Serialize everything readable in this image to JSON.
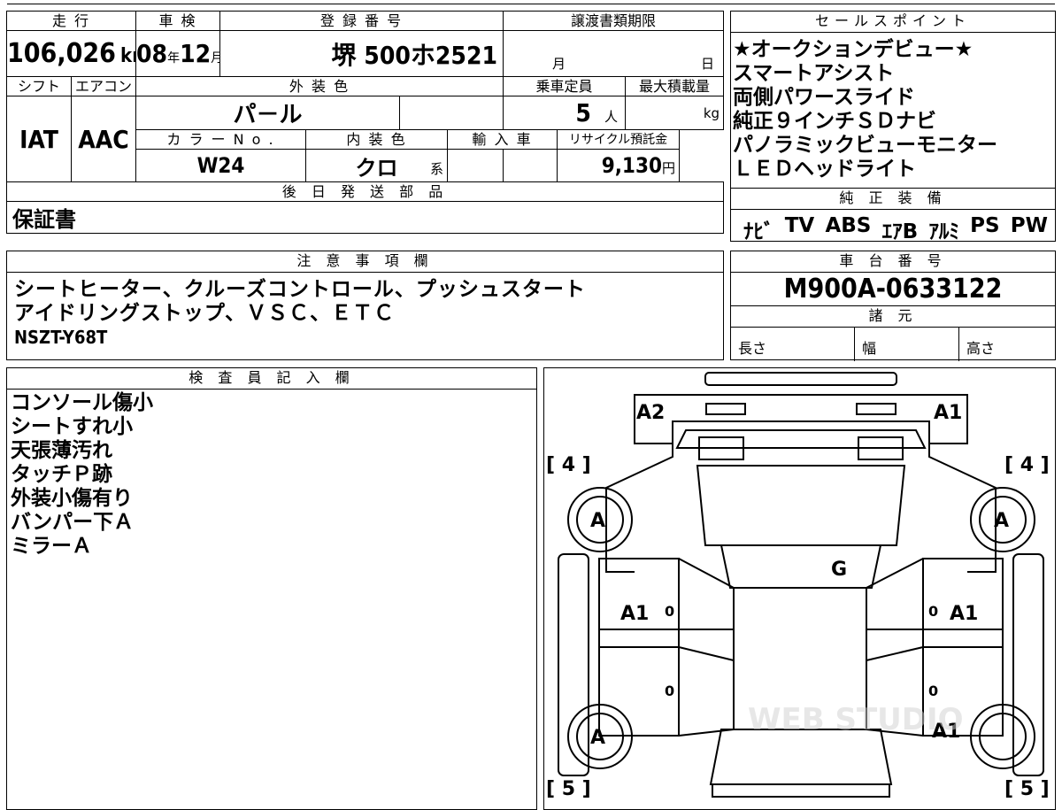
{
  "main_table": {
    "h_mileage": "走 行",
    "h_inspection": "車 検",
    "h_registration": "登 録 番 号",
    "h_transfer_deadline": "譲渡書類期限",
    "mileage": "106,026",
    "mileage_unit": "km",
    "inspection_year": "08",
    "inspection_year_unit": "年",
    "inspection_month": "12",
    "inspection_month_unit": "月",
    "registration_plate": "堺 500ホ2521",
    "transfer_month_unit": "月",
    "transfer_day_unit": "日",
    "h_shift": "シフト",
    "h_aircon": "エアコン",
    "h_exterior_color": "外 装 色",
    "h_capacity": "乗車定員",
    "h_max_load": "最大積載量",
    "shift": "IAT",
    "aircon": "AAC",
    "exterior_color": "パ－ル",
    "capacity": "5",
    "capacity_unit": "人",
    "max_load_unit": "kg",
    "h_color_no": "カ ラ ー N o .",
    "h_interior_color": "内 装 色",
    "h_imported": "輸 入 車",
    "h_recycle_fee": "リサイクル預託金",
    "color_no": "W24",
    "interior_color": "クロ",
    "interior_color_suffix": "系",
    "recycle_fee": "9,130",
    "recycle_fee_unit": "円",
    "h_later_parts": "後 日 発 送 部 品",
    "later_parts": "保証書"
  },
  "sales_points": {
    "header": "セールスポイント",
    "lines": [
      "★オークションデビュー★",
      "スマートアシスト",
      "両側パワースライド",
      "純正９インチＳＤナビ",
      "パノラミックビューモニター",
      "ＬＥＤヘッドライト"
    ]
  },
  "standard_equipment": {
    "header": "純 正 装 備",
    "items": [
      "ﾅﾋﾞ",
      "TV",
      "ABS",
      "ｴｱB",
      "ｱﾙﾐ",
      "PS",
      "PW"
    ]
  },
  "notes": {
    "header": "注 意 事 項 欄",
    "lines": [
      "シートヒーター、クルーズコントロール、プッシュスタート",
      "アイドリングストップ、ＶＳＣ、ＥＴＣ"
    ],
    "model_code": "NSZT-Y68T"
  },
  "chassis": {
    "header": "車 台 番 号",
    "number": "M900A-0633122",
    "specs_header": "諸 元",
    "length_label": "長さ",
    "width_label": "幅",
    "height_label": "高さ"
  },
  "inspector": {
    "header": "検 査 員 記 入 欄",
    "lines": [
      "コンソール傷小",
      "シートすれ小",
      "天張薄汚れ",
      "タッチＰ跡",
      "外装小傷有り",
      "バンパー下Ａ",
      "ミラーＡ"
    ]
  },
  "diagram": {
    "front_left": "A2",
    "front_right": "A1",
    "tire_fl_rating": "[ 4 ]",
    "tire_fr_rating": "[ 4 ]",
    "tire_rl_rating": "[ 5 ]",
    "tire_rr_rating": "[ 5 ]",
    "wheel_fl": "A",
    "wheel_fr": "A",
    "wheel_rl": "A",
    "windshield": "G",
    "front_door_left": "A1",
    "front_door_right": "A1",
    "rear_quarter_right": "A1",
    "small_marks": [
      "0",
      "0",
      "0",
      "0"
    ],
    "watermark": "WEB STUDIO"
  }
}
